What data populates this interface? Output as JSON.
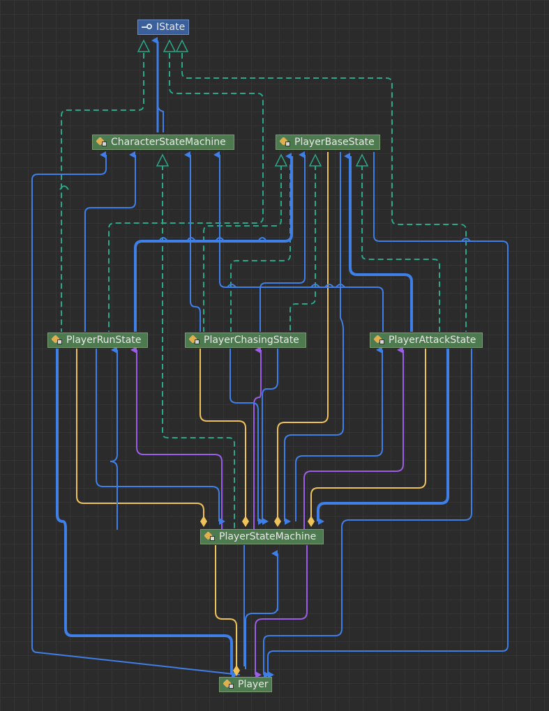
{
  "nodes": {
    "istate": {
      "label": "IState",
      "kind": "interface",
      "icon": "interface-icon"
    },
    "character_state_machine": {
      "label": "CharacterStateMachine",
      "kind": "class",
      "icon": "class-icon"
    },
    "player_base_state": {
      "label": "PlayerBaseState",
      "kind": "class",
      "icon": "class-icon"
    },
    "player_run_state": {
      "label": "PlayerRunState",
      "kind": "class",
      "icon": "class-icon"
    },
    "player_chasing_state": {
      "label": "PlayerChasingState",
      "kind": "class",
      "icon": "class-icon"
    },
    "player_attack_state": {
      "label": "PlayerAttackState",
      "kind": "class",
      "icon": "class-icon"
    },
    "player_state_machine": {
      "label": "PlayerStateMachine",
      "kind": "class",
      "icon": "class-icon"
    },
    "player": {
      "label": "Player",
      "kind": "class",
      "icon": "class-icon"
    }
  },
  "colors": {
    "background": "#2b2b2b",
    "grid": "#353535",
    "class_fill": "#4e7a4f",
    "interface_fill": "#3b5f9a",
    "dependency": "#3f7fe8",
    "implements": "#2aa88a",
    "aggregation": "#f0c25a",
    "create": "#9a5fe6"
  }
}
